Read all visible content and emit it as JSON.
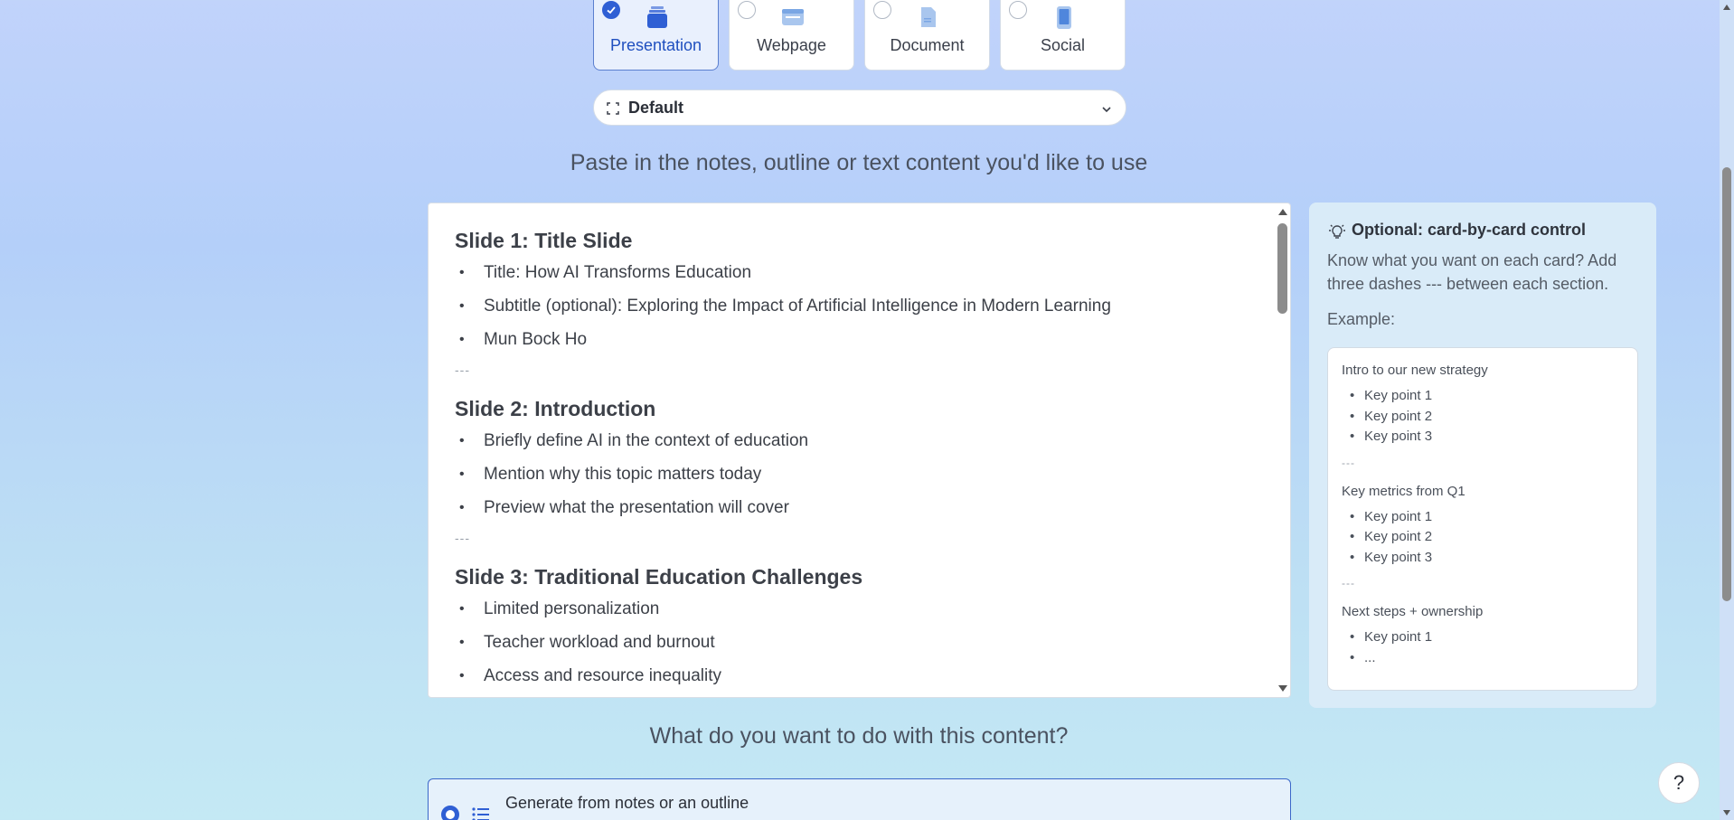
{
  "content_types": [
    {
      "label": "Presentation",
      "selected": true,
      "icon": "presentation-icon"
    },
    {
      "label": "Webpage",
      "selected": false,
      "icon": "webpage-icon"
    },
    {
      "label": "Document",
      "selected": false,
      "icon": "document-icon"
    },
    {
      "label": "Social",
      "selected": false,
      "icon": "social-icon"
    }
  ],
  "theme_dropdown": {
    "icon": "aspect-ratio-icon",
    "label": "Default"
  },
  "paste_heading": "Paste in the notes, outline or text content you'd like to use",
  "editor": {
    "separator": "---",
    "slides": [
      {
        "title": "Slide 1: Title Slide",
        "bullets": [
          "Title: How AI Transforms Education",
          "Subtitle (optional): Exploring the Impact of Artificial Intelligence in Modern Learning",
          "Mun Bock Ho"
        ]
      },
      {
        "title": "Slide 2: Introduction",
        "bullets": [
          "Briefly define AI in the context of education",
          "Mention why this topic matters today",
          "Preview what the presentation will cover"
        ]
      },
      {
        "title": "Slide 3: Traditional Education Challenges",
        "bullets": [
          "Limited personalization",
          "Teacher workload and burnout",
          "Access and resource inequality"
        ]
      }
    ]
  },
  "tip_panel": {
    "title": "Optional: card-by-card control",
    "description": "Know what you want on each card? Add three dashes --- between each section.",
    "example_label": "Example:",
    "example": {
      "separator": "---",
      "sections": [
        {
          "title": "Intro to our new strategy",
          "bullets": [
            "Key point 1",
            "Key point 2",
            "Key point 3"
          ]
        },
        {
          "title": "Key metrics from Q1",
          "bullets": [
            "Key point 1",
            "Key point 2",
            "Key point 3"
          ]
        },
        {
          "title": "Next steps + ownership",
          "bullets": [
            "Key point 1",
            "..."
          ]
        }
      ]
    }
  },
  "action_heading": "What do you want to do with this content?",
  "mode_option": {
    "label": "Generate from notes or an outline",
    "selected": true
  },
  "help_button": "?",
  "colors": {
    "accent": "#2f5fd4",
    "selected_card_bg": "#e9f0fd",
    "panel_bg": "#d9ebf8"
  }
}
